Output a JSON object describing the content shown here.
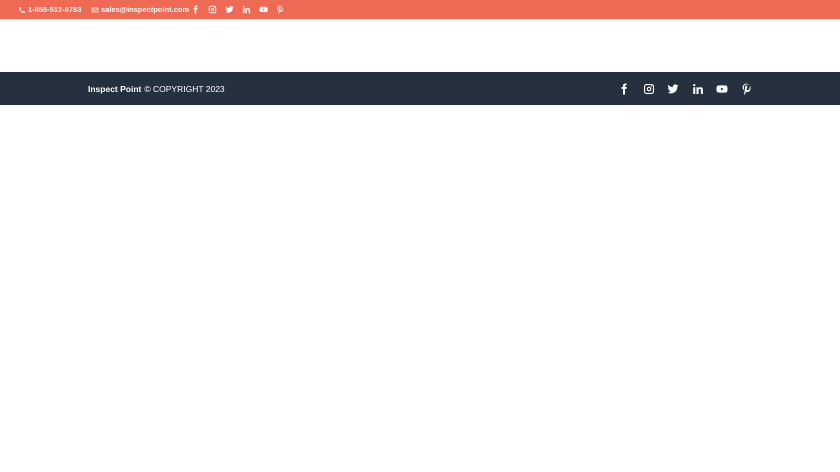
{
  "colors": {
    "topbar_bg": "#ee6a54",
    "footer_bg": "#263140",
    "text": "#ffffff"
  },
  "topbar": {
    "phone": "1-855-512-8783",
    "phone_icon": "phone-icon",
    "email": "sales@inspectpoint.com",
    "email_icon": "envelope-icon",
    "social": [
      "facebook-icon",
      "instagram-icon",
      "twitter-icon",
      "linkedin-icon",
      "youtube-icon",
      "pinterest-icon"
    ]
  },
  "footer": {
    "brand": "Inspect Point",
    "copyright": "© COPYRIGHT 2023",
    "social": [
      "facebook-icon",
      "instagram-icon",
      "twitter-icon",
      "linkedin-icon",
      "youtube-icon",
      "pinterest-icon"
    ]
  }
}
